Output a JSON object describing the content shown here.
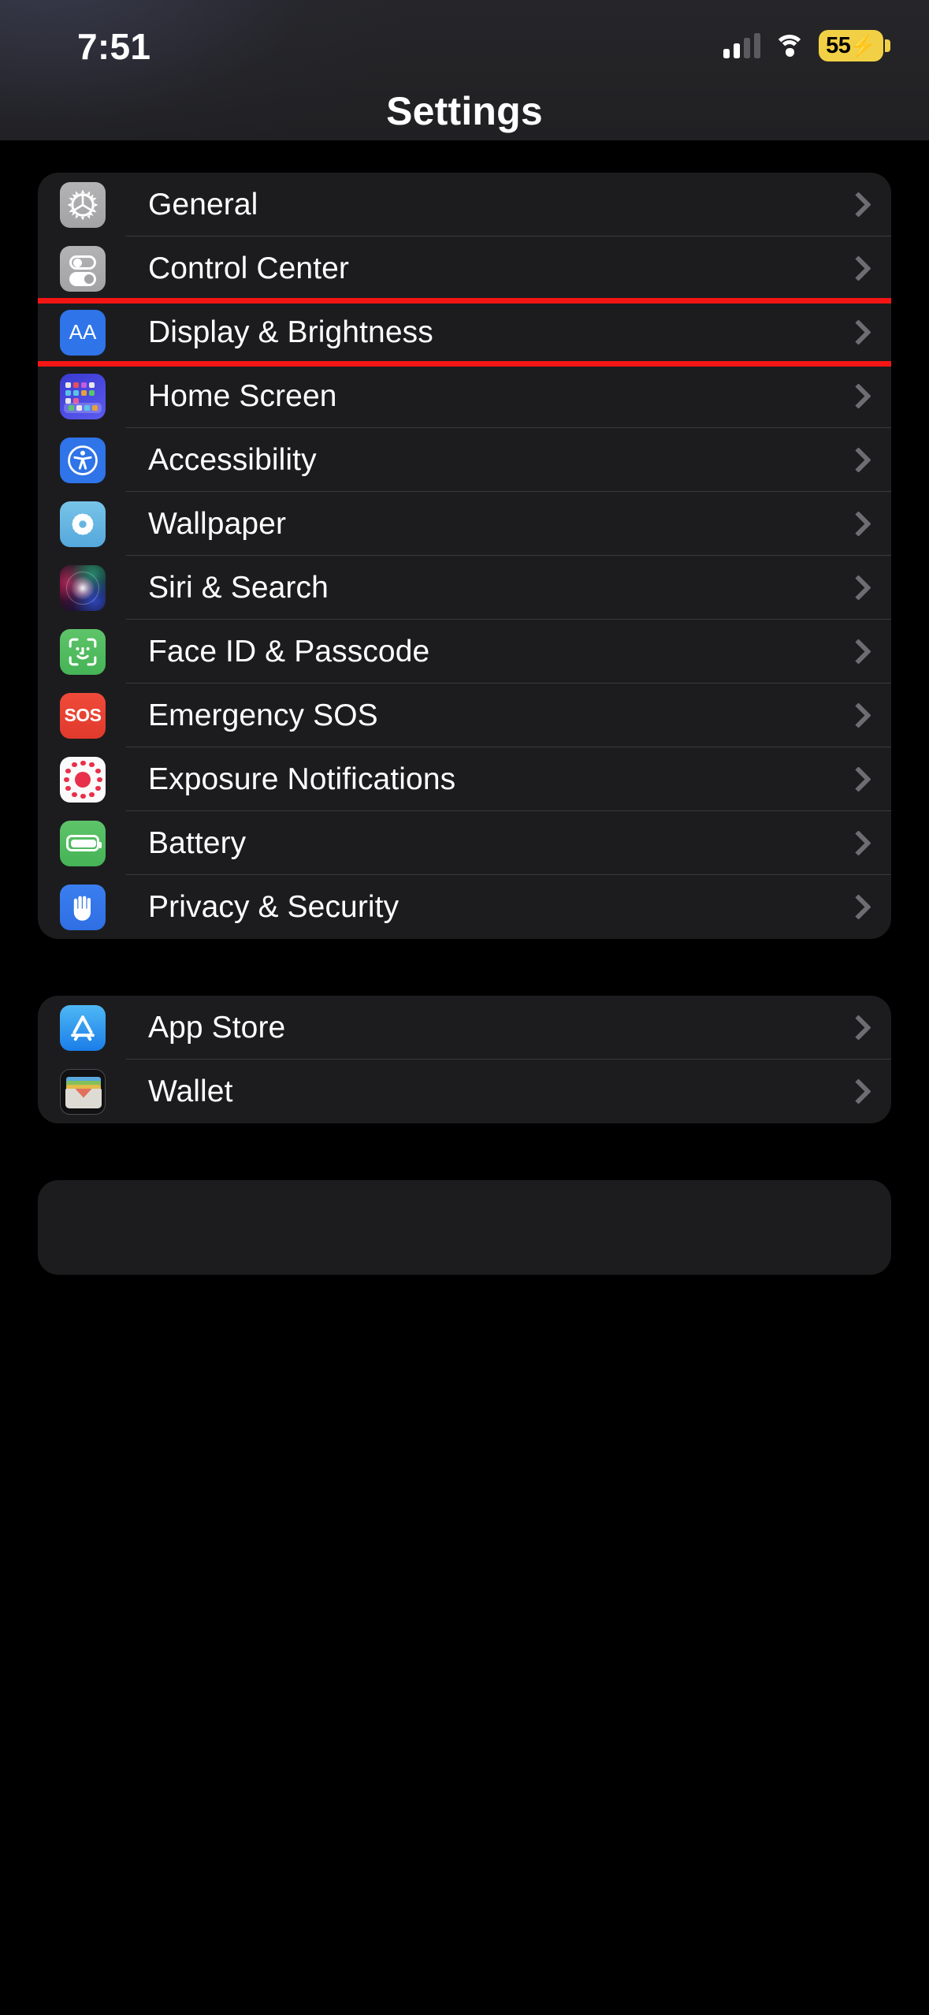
{
  "status_bar": {
    "time": "7:51",
    "cellular_icon": "cellular-signal-icon",
    "wifi_icon": "wifi-icon",
    "battery": {
      "percent": "55",
      "charging_glyph": "⚡",
      "badge_color": "#f2d045",
      "charging": true
    }
  },
  "header": {
    "title": "Settings"
  },
  "highlight": {
    "color": "#f51515",
    "target_row": "Display & Brightness"
  },
  "groups": [
    {
      "id": "group-system",
      "rows": [
        {
          "label": "General",
          "icon": "gear-icon",
          "icon_color": "#a9a9ac",
          "chevron": "chevron-right-icon",
          "highlighted": false
        },
        {
          "label": "Control Center",
          "icon": "toggles-icon",
          "icon_color": "#a9a9ac",
          "chevron": "chevron-right-icon",
          "highlighted": false
        },
        {
          "label": "Display & Brightness",
          "icon": "display-brightness-aa-icon",
          "icon_color": "#2f74e8",
          "chevron": "chevron-right-icon",
          "highlighted": true
        },
        {
          "label": "Home Screen",
          "icon": "home-screen-grid-icon",
          "icon_color": "#4a4ae0",
          "chevron": "chevron-right-icon",
          "highlighted": false
        },
        {
          "label": "Accessibility",
          "icon": "accessibility-person-icon",
          "icon_color": "#2f74e8",
          "chevron": "chevron-right-icon",
          "highlighted": false
        },
        {
          "label": "Wallpaper",
          "icon": "wallpaper-flower-icon",
          "icon_color": "#55a8dc",
          "chevron": "chevron-right-icon",
          "highlighted": false
        },
        {
          "label": "Siri & Search",
          "icon": "siri-orb-icon",
          "icon_color": "#1a1020",
          "chevron": "chevron-right-icon",
          "highlighted": false
        },
        {
          "label": "Face ID & Passcode",
          "icon": "face-id-icon",
          "icon_color": "#45b356",
          "chevron": "chevron-right-icon",
          "highlighted": false
        },
        {
          "label": "Emergency SOS",
          "icon": "sos-icon",
          "icon_color": "#e03a2c",
          "chevron": "chevron-right-icon",
          "highlighted": false
        },
        {
          "label": "Exposure Notifications",
          "icon": "exposure-notifications-icon",
          "icon_color": "#e8304a",
          "chevron": "chevron-right-icon",
          "highlighted": false
        },
        {
          "label": "Battery",
          "icon": "battery-icon",
          "icon_color": "#45b356",
          "chevron": "chevron-right-icon",
          "highlighted": false
        },
        {
          "label": "Privacy & Security",
          "icon": "privacy-hand-icon",
          "icon_color": "#2f6fe3",
          "chevron": "chevron-right-icon",
          "highlighted": false
        }
      ]
    },
    {
      "id": "group-stores",
      "rows": [
        {
          "label": "App Store",
          "icon": "app-store-icon",
          "icon_color": "#1a7ee8",
          "chevron": "chevron-right-icon",
          "highlighted": false
        },
        {
          "label": "Wallet",
          "icon": "wallet-icon",
          "icon_color": "#dedbd4",
          "chevron": "chevron-right-icon",
          "highlighted": false
        }
      ]
    },
    {
      "id": "group-partial",
      "rows": []
    }
  ]
}
